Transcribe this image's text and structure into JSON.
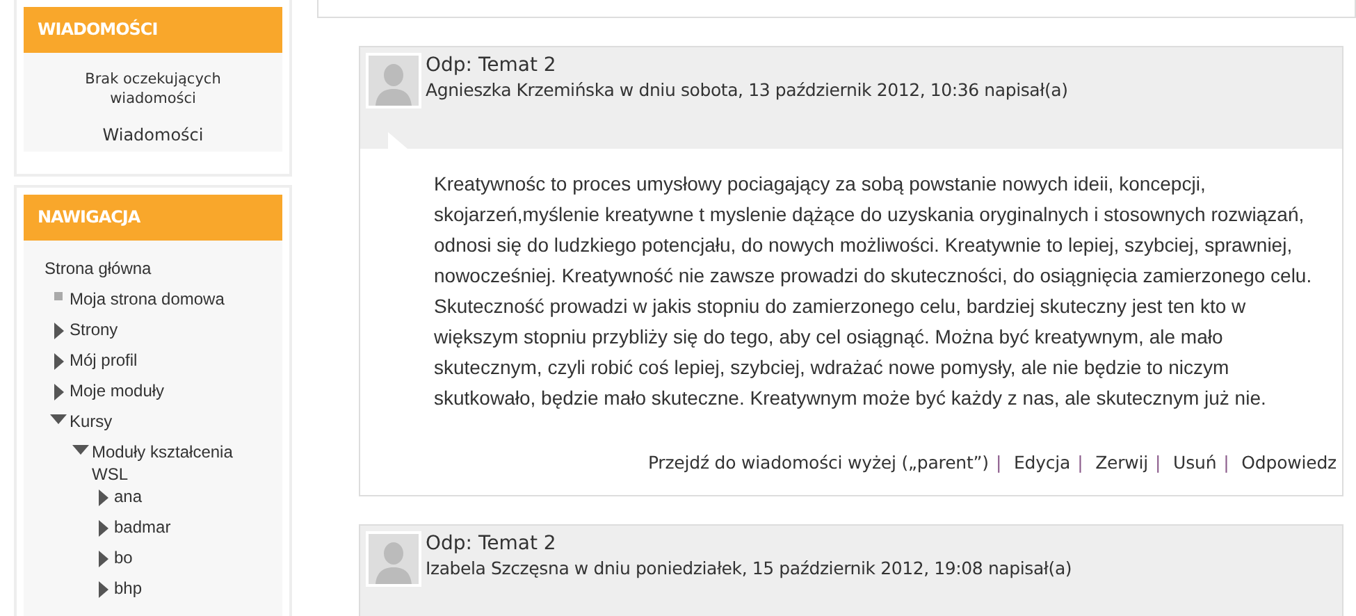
{
  "blocks": {
    "messages": {
      "title": "WIADOMOŚCI",
      "note": "Brak oczekujących wiadomości",
      "link": "Wiadomości"
    },
    "navigation": {
      "title": "NAWIGACJA",
      "items": [
        {
          "label": "Strona główna",
          "kind": "root",
          "children": [
            {
              "label": "Moja strona domowa",
              "kind": "leaf"
            },
            {
              "label": "Strony",
              "kind": "branch",
              "expanded": false
            },
            {
              "label": "Mój profil",
              "kind": "branch",
              "expanded": false
            },
            {
              "label": "Moje moduły",
              "kind": "branch",
              "expanded": false
            },
            {
              "label": "Kursy",
              "kind": "branch",
              "expanded": true,
              "children": [
                {
                  "label": "Moduły kształcenia WSL",
                  "kind": "branch",
                  "expanded": true,
                  "children": [
                    {
                      "label": "ana",
                      "kind": "branch",
                      "expanded": false
                    },
                    {
                      "label": "badmar",
                      "kind": "branch",
                      "expanded": false
                    },
                    {
                      "label": "bo",
                      "kind": "branch",
                      "expanded": false
                    },
                    {
                      "label": "bhp",
                      "kind": "branch",
                      "expanded": false
                    }
                  ]
                }
              ]
            }
          ]
        }
      ]
    }
  },
  "posts": [
    {
      "subject": "Odp: Temat 2",
      "byline": "Agnieszka Krzemińska w dniu sobota, 13 październik 2012, 10:36 napisał(a)",
      "body": "Kreatywnośc to proces umysłowy pociagający za sobą powstanie nowych ideii, koncepcji, skojarzeń,myślenie kreatywne t myslenie dążące do uzyskania oryginalnych i stosownych rozwiązań, odnosi się do ludzkiego potencjału, do nowych możliwości. Kreatywnie to lepiej, szybciej, sprawniej, nowocześniej. Kreatywność nie zawsze prowadzi do skuteczności, do osiągnięcia zamierzonego celu. Skuteczność prowadzi w jakis stopniu do zamierzonego celu, bardziej skuteczny jest ten kto w większym stopniu przybliży się do tego, aby cel osiągnąć. Można być kreatywnym, ale mało skutecznym, czyli robić coś lepiej, szybciej, wdrażać nowe pomysły, ale nie będzie to niczym skutkowało, będzie mało skuteczne. Kreatywnym może być każdy z nas, ale skutecznym już nie.",
      "separator": "|",
      "links": [
        "Przejdź do wiadomości wyżej („parent”)",
        "Edycja",
        "Zerwij",
        "Usuń",
        "Odpowiedz"
      ]
    },
    {
      "subject": "Odp: Temat 2",
      "byline": "Izabela Szczęsna w dniu poniedziałek, 15 październik 2012, 19:08 napisał(a)"
    }
  ]
}
